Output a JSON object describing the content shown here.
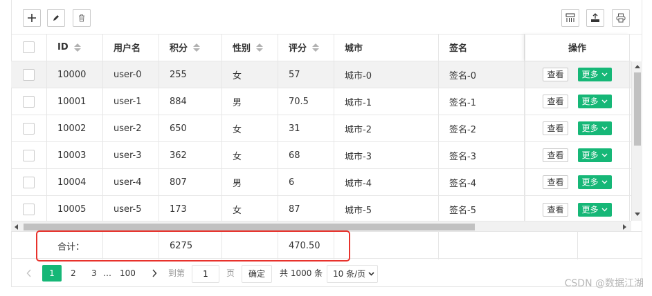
{
  "columns": [
    {
      "key": "id",
      "label": "ID",
      "sortable": true
    },
    {
      "key": "username",
      "label": "用户名",
      "sortable": false
    },
    {
      "key": "score",
      "label": "积分",
      "sortable": true
    },
    {
      "key": "gender",
      "label": "性别",
      "sortable": true
    },
    {
      "key": "rating",
      "label": "评分",
      "sortable": true
    },
    {
      "key": "city",
      "label": "城市",
      "sortable": false
    },
    {
      "key": "sign",
      "label": "签名",
      "sortable": false
    },
    {
      "key": "ops",
      "label": "操作",
      "sortable": false
    }
  ],
  "rows": [
    {
      "id": "10000",
      "username": "user-0",
      "score": "255",
      "gender": "女",
      "rating": "57",
      "city": "城市-0",
      "sign": "签名-0"
    },
    {
      "id": "10001",
      "username": "user-1",
      "score": "884",
      "gender": "男",
      "rating": "70.5",
      "city": "城市-1",
      "sign": "签名-1"
    },
    {
      "id": "10002",
      "username": "user-2",
      "score": "650",
      "gender": "女",
      "rating": "31",
      "city": "城市-2",
      "sign": "签名-2"
    },
    {
      "id": "10003",
      "username": "user-3",
      "score": "362",
      "gender": "女",
      "rating": "68",
      "city": "城市-3",
      "sign": "签名-3"
    },
    {
      "id": "10004",
      "username": "user-4",
      "score": "807",
      "gender": "男",
      "rating": "6",
      "city": "城市-4",
      "sign": "签名-4"
    },
    {
      "id": "10005",
      "username": "user-5",
      "score": "173",
      "gender": "女",
      "rating": "87",
      "city": "城市-5",
      "sign": "签名-5"
    }
  ],
  "row_actions": {
    "view": "查看",
    "more": "更多"
  },
  "totals": {
    "label": "合计：",
    "score": "6275",
    "rating": "470.50"
  },
  "pagination": {
    "current": "1",
    "pages": [
      "2",
      "3"
    ],
    "ellipsis": "…",
    "last": "100",
    "goto_label": "到第",
    "goto_value": "1",
    "page_unit": "页",
    "confirm": "确定",
    "total_text": "共 1000 条",
    "per_page": "10 条/页"
  },
  "watermark": "CSDN @数据江湖",
  "colors": {
    "accent": "#16b777",
    "highlight": "#e8322c"
  }
}
